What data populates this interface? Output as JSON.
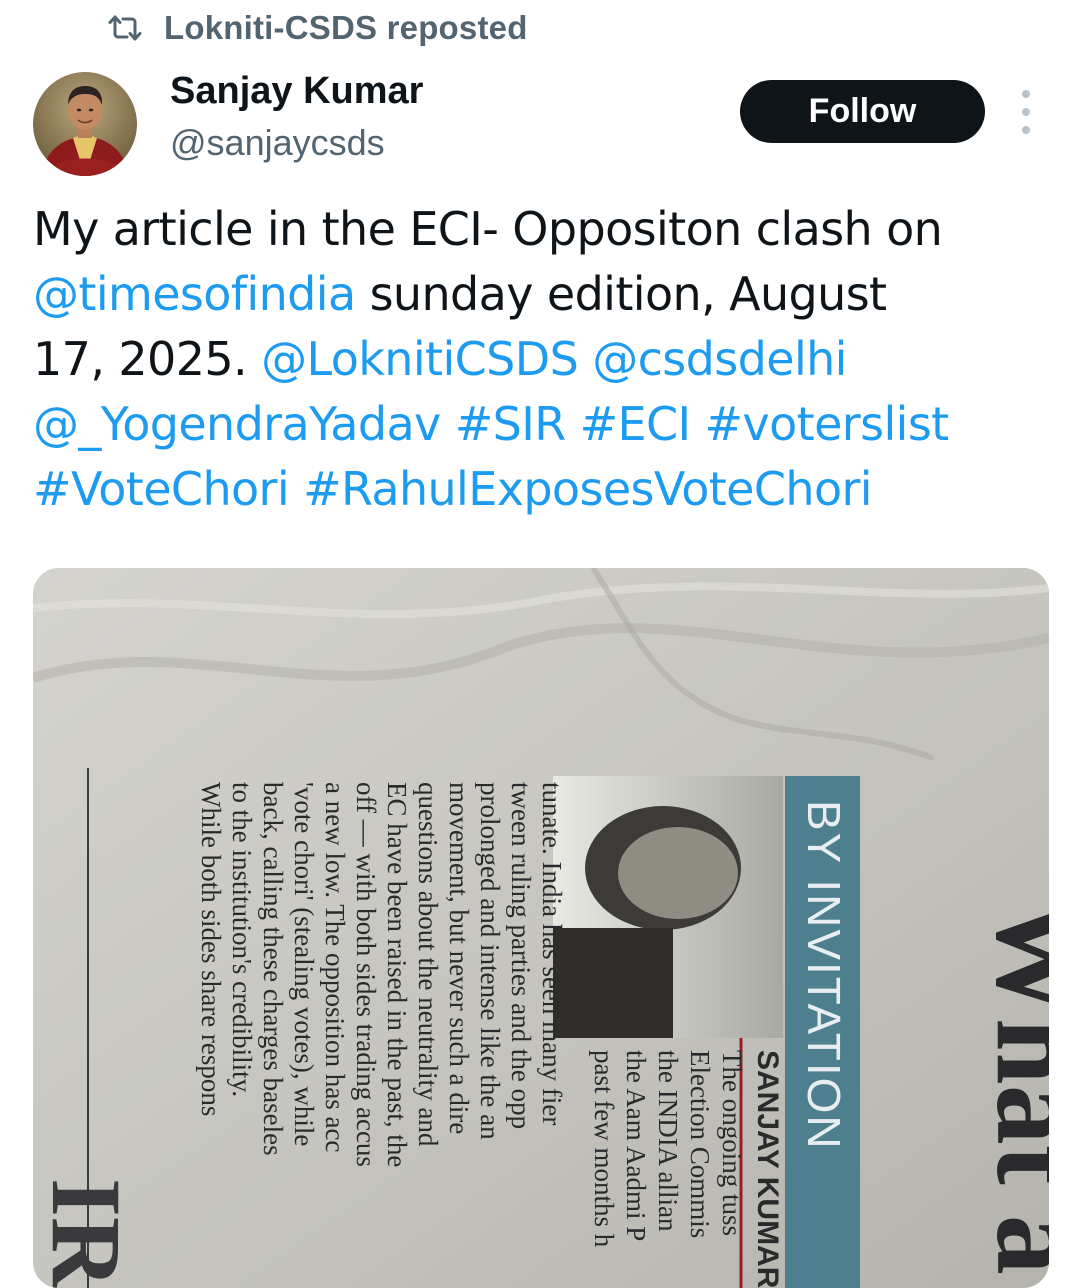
{
  "repost": {
    "icon": "repost-icon",
    "label": "Lokniti-CSDS reposted"
  },
  "author": {
    "name": "Sanjay Kumar",
    "handle": "@sanjaycsds",
    "avatar": "author-avatar"
  },
  "actions": {
    "follow_label": "Follow",
    "more_icon": "more-options-icon"
  },
  "tweet": {
    "lines": [
      [
        {
          "text": "My article in the ECI- Oppositon clash on",
          "type": "text"
        }
      ],
      [
        {
          "text": "@timesofindia",
          "type": "mention"
        },
        {
          "text": " sunday edition, August",
          "type": "text"
        }
      ],
      [
        {
          "text": "17, 2025. ",
          "type": "text"
        },
        {
          "text": "@LoknitiCSDS",
          "type": "mention"
        },
        {
          "text": " ",
          "type": "text"
        },
        {
          "text": "@csdsdelhi",
          "type": "mention"
        }
      ],
      [
        {
          "text": "@_YogendraYadav",
          "type": "mention"
        },
        {
          "text": " ",
          "type": "text"
        },
        {
          "text": "#SIR",
          "type": "hashtag"
        },
        {
          "text": " ",
          "type": "text"
        },
        {
          "text": "#ECI",
          "type": "hashtag"
        },
        {
          "text": " ",
          "type": "text"
        },
        {
          "text": "#voterslist",
          "type": "hashtag"
        }
      ],
      [
        {
          "text": "#VoteChori",
          "type": "hashtag"
        },
        {
          "text": " ",
          "type": "text"
        },
        {
          "text": "#RahulExposesVoteChori",
          "type": "hashtag"
        }
      ]
    ]
  },
  "media": {
    "headline_fragment": "What a",
    "column_label": "BY INVITATION",
    "byline": "SANJAY KUMAR",
    "article_lines": [
      "The ongoing tuss",
      "Election Commis",
      "the INDIA allian",
      "the Aam Aadmi P",
      "past few months h",
      "tunate. India has seen many fier",
      "tween ruling parties and the opp",
      "prolonged and intense like the an",
      "movement, but never such a dire",
      "questions about the neutrality and",
      "EC have been raised in the past, the",
      "off — with both sides trading accus",
      "a new low. The opposition has acc",
      "'vote chori' (stealing votes), while",
      "back, calling these charges baseles",
      "to the institution's credibility.",
      "While both sides share respons"
    ],
    "colors": {
      "paper": "#c9c8c3",
      "column_band": "#4d7f8e",
      "ink": "#2a2a2c"
    }
  }
}
